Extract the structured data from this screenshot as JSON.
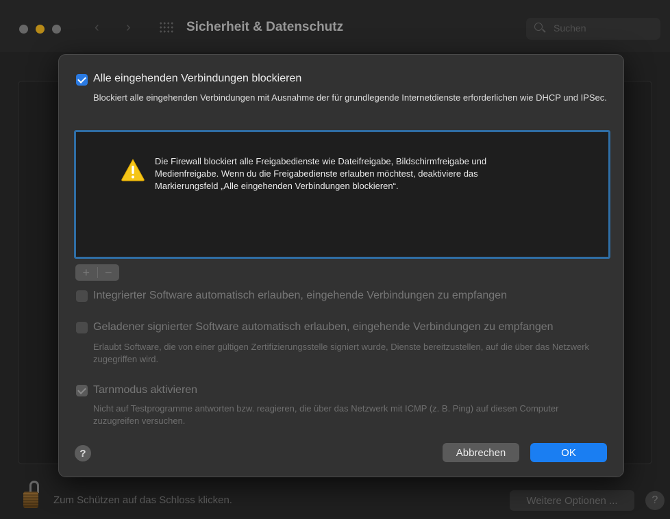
{
  "window": {
    "title": "Sicherheit & Datenschutz",
    "search_placeholder": "Suchen",
    "back_arrow": "‹",
    "forward_arrow": "›"
  },
  "bottom_bar": {
    "lock_text": "Zum Schützen auf das Schloss klicken.",
    "more_options_label": "Weitere Optionen ...",
    "help_label": "?"
  },
  "sheet": {
    "block_all": {
      "checked": true,
      "label": "Alle eingehenden Verbindungen blockieren",
      "description": "Blockiert alle eingehenden Verbindungen mit Ausnahme der für grundlegende Internetdienste erforderlichen wie DHCP und IPSec."
    },
    "warning": {
      "icon": "warning-triangle-icon",
      "text": "Die Firewall blockiert alle Freigabedienste wie Dateifreigabe, Bildschirmfreigabe und Medienfreigabe. Wenn du die Freigabedienste erlauben möchtest, deaktiviere das Markierungsfeld „Alle eingehenden Verbindungen blockieren“."
    },
    "add_label": "+",
    "remove_label": "−",
    "builtin_software": {
      "checked": false,
      "enabled": false,
      "label": "Integrierter Software automatisch erlauben, eingehende Verbindungen zu empfangen"
    },
    "signed_software": {
      "checked": false,
      "enabled": false,
      "label": "Geladener signierter Software automatisch erlauben, eingehende Verbindungen zu empfangen",
      "description": "Erlaubt Software, die von einer gültigen Zertifizierungsstelle signiert wurde, Dienste bereitzustellen, auf die über das Netzwerk zugegriffen wird."
    },
    "stealth_mode": {
      "checked": true,
      "enabled": false,
      "label": "Tarnmodus aktivieren",
      "description": "Nicht auf Testprogramme antworten bzw. reagieren, die über das Netzwerk mit ICMP (z. B. Ping) auf diesen Computer zuzugreifen versuchen."
    },
    "help_label": "?",
    "cancel_label": "Abbrechen",
    "ok_label": "OK"
  },
  "colors": {
    "accent": "#1a7ef2",
    "checkbox_blue": "#2a7ae2",
    "focus_ring": "#2f6ea5",
    "warning_yellow": "#f5c518"
  }
}
